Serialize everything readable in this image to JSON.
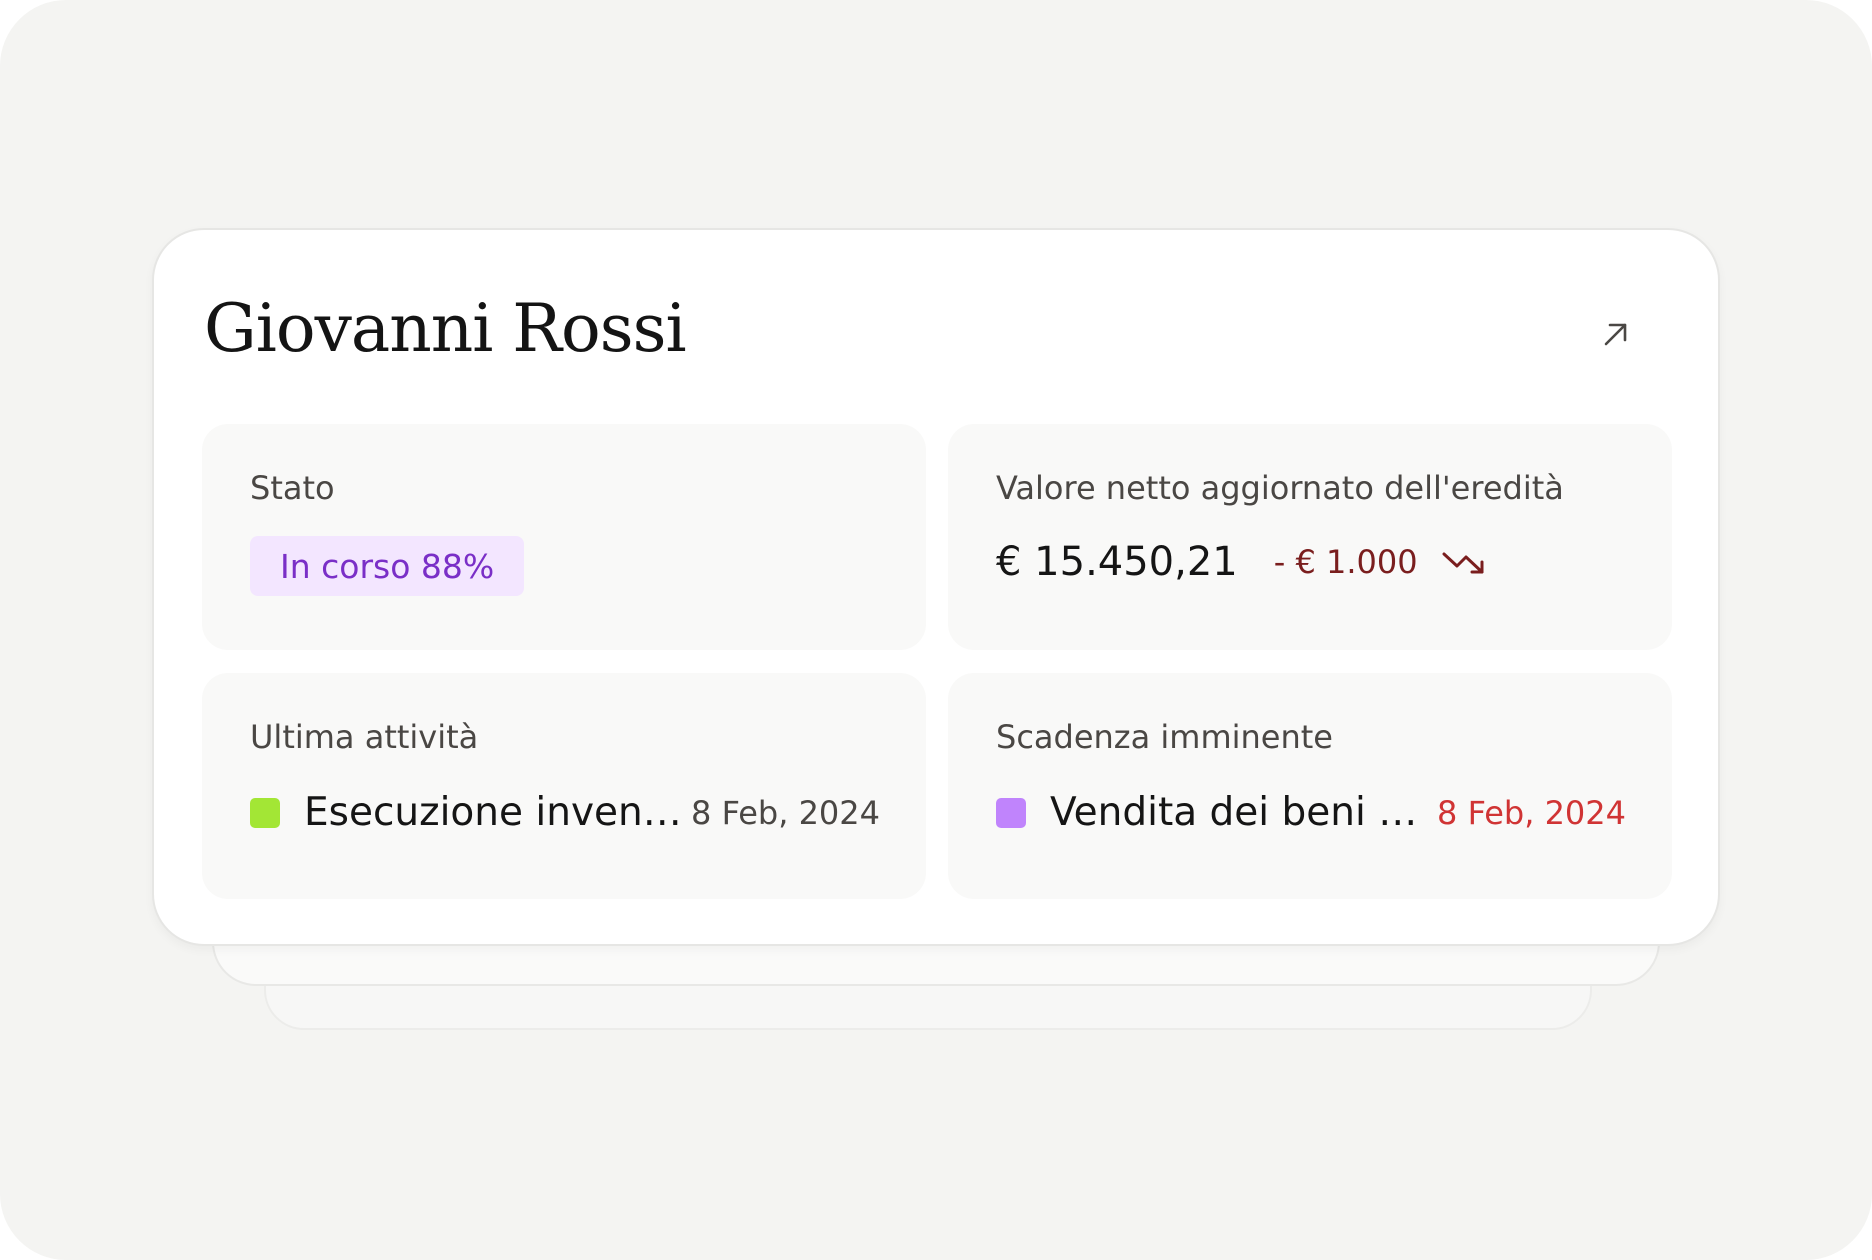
{
  "person": {
    "name": "Giovanni Rossi"
  },
  "icons": {
    "open": "arrow-up-right-icon",
    "trend": "trending-down-icon"
  },
  "status": {
    "label": "Stato",
    "badge": "In corso 88%"
  },
  "estate": {
    "label": "Valore netto aggiornato dell'eredità",
    "value": "€ 15.450,21",
    "delta": "- € 1.000"
  },
  "last_activity": {
    "label": "Ultima attività",
    "title": "Esecuzione invent...",
    "date": "8 Feb, 2024",
    "marker_color": "#a3e635"
  },
  "upcoming_deadline": {
    "label": "Scadenza imminente",
    "title": "Vendita dei beni m...",
    "date": "8 Feb, 2024",
    "marker_color": "#c084fc"
  },
  "colors": {
    "badge_bg": "#f3e6ff",
    "badge_text": "#7a2fc7",
    "delta_text": "#7a1e1e",
    "deadline_date": "#d03434",
    "activity_date": "#4a4744"
  }
}
